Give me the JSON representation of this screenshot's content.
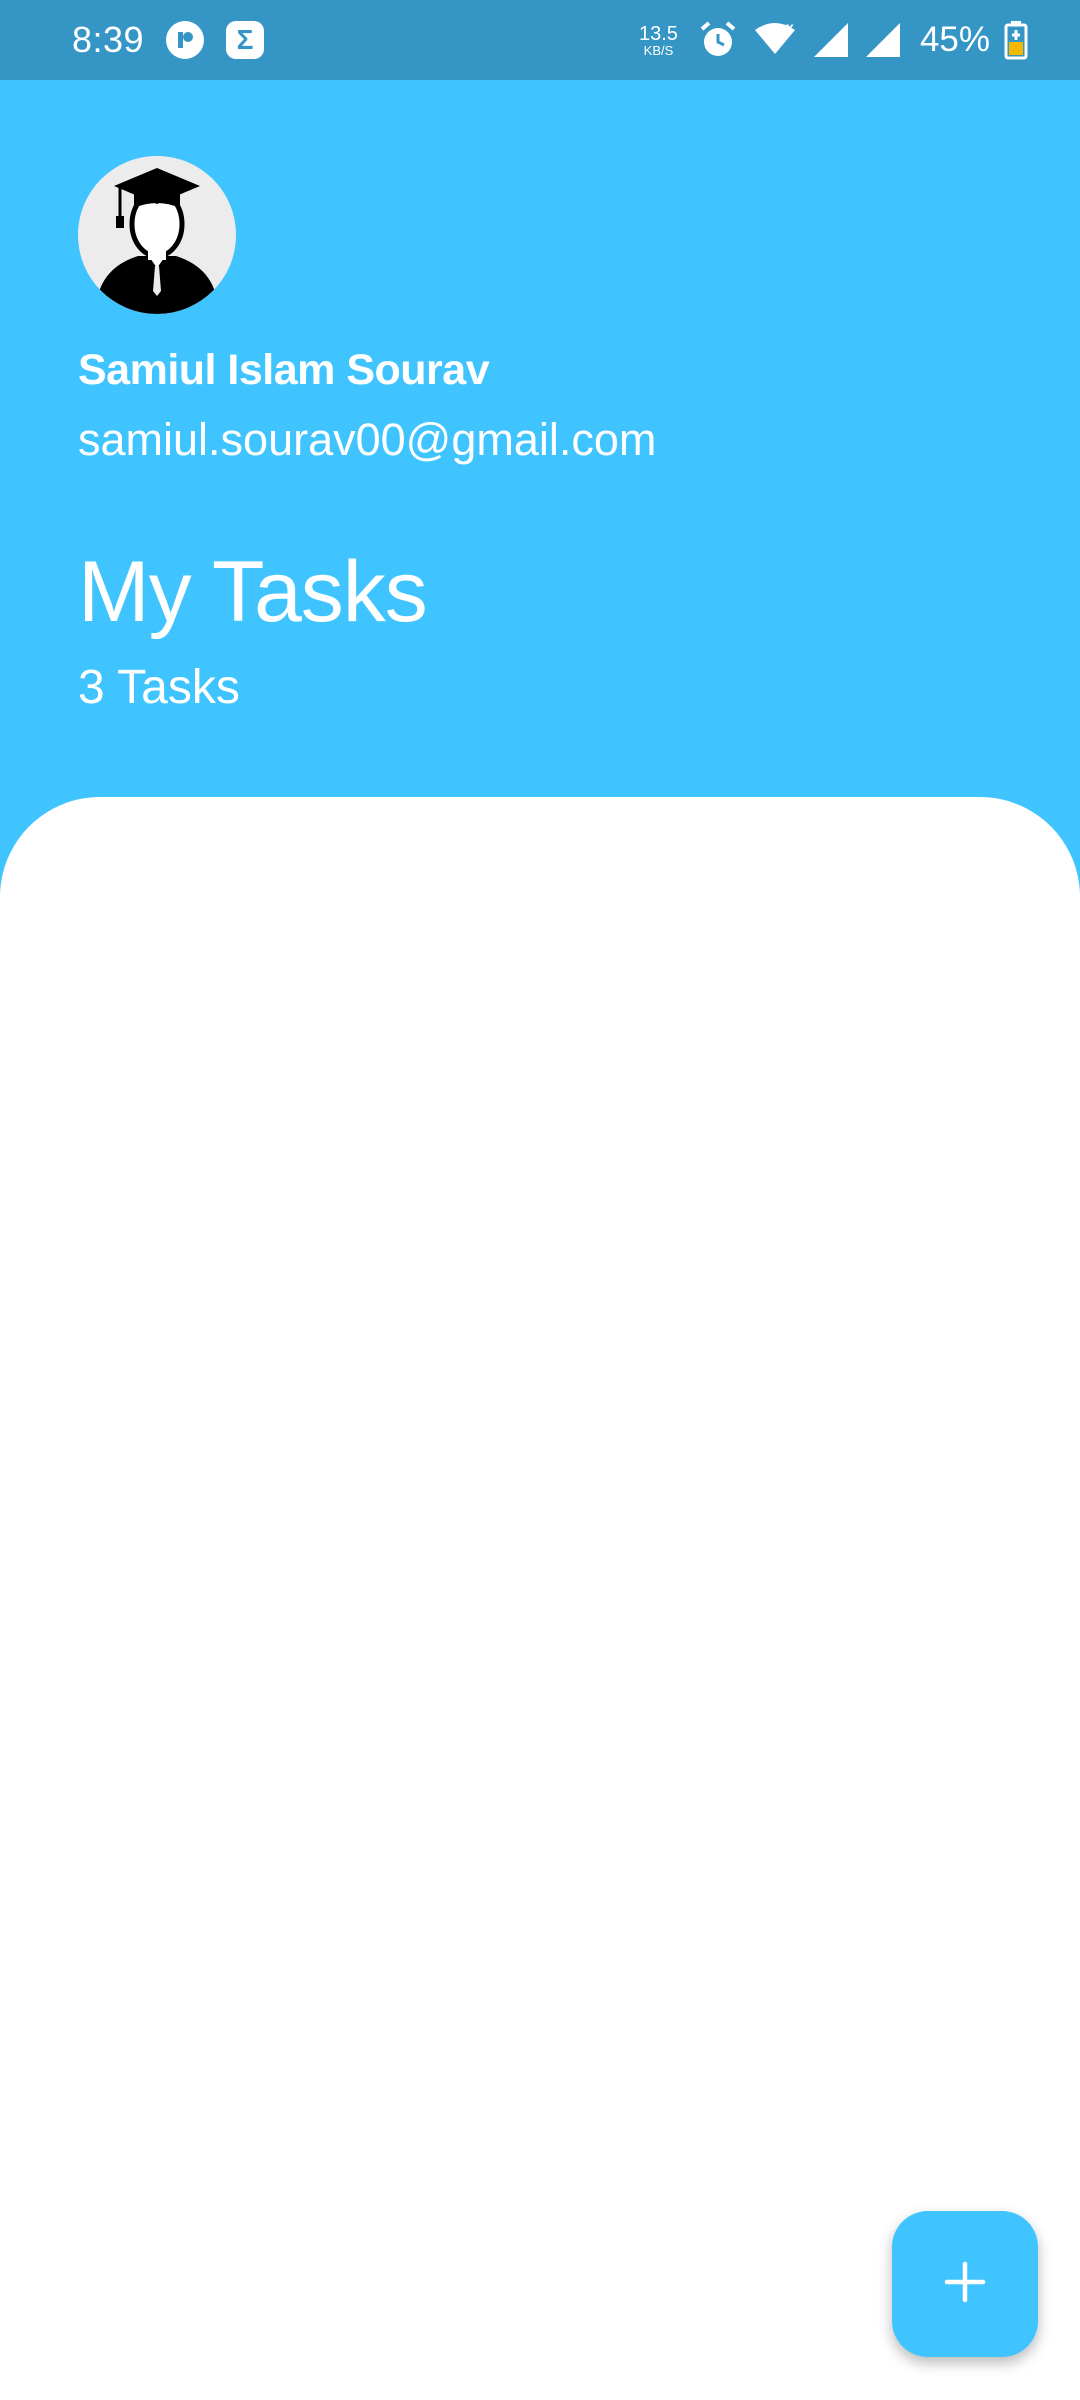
{
  "status_bar": {
    "time": "8:39",
    "net_speed_value": "13.5",
    "net_speed_unit": "KB/S",
    "battery": "45%",
    "icons": [
      "app-notification-icon",
      "sigma-notification-icon",
      "alarm-icon",
      "wifi-icon",
      "signal-icon",
      "signal-icon",
      "battery-charging-icon"
    ]
  },
  "profile": {
    "avatar_icon": "graduate-avatar",
    "name": "Samiul Islam Sourav",
    "email": "samiul.sourav00@gmail.com"
  },
  "header": {
    "title": "My Tasks",
    "count": "3 Tasks"
  },
  "fab": {
    "icon": "plus-icon"
  },
  "colors": {
    "primary": "#40C4FF",
    "status_bar": "#3596C6",
    "panel": "#FFFFFF"
  }
}
